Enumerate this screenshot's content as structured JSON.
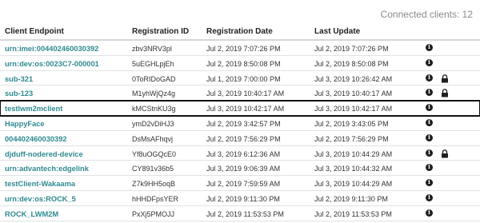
{
  "connected_clients": "Connected clients: 12",
  "columns": {
    "endpoint": "Client Endpoint",
    "registration_id": "Registration ID",
    "registration_date": "Registration Date",
    "last_update": "Last Update"
  },
  "colors": {
    "link": "#2e8a91",
    "header_text": "#222222",
    "muted": "#8a8a8a"
  },
  "rows": [
    {
      "endpoint": "urn:imei:004402460030392",
      "reg_id": "zbv3NRV3pl",
      "reg_date": "Jul 2, 2019 7:07:26 PM",
      "last_update": "Jul 2, 2019 7:07:26 PM",
      "icons": [
        "info-icon"
      ]
    },
    {
      "endpoint": "urn:dev:os:0023C7-000001",
      "reg_id": "5uEGHLpjEh",
      "reg_date": "Jul 2, 2019 8:50:08 PM",
      "last_update": "Jul 2, 2019 8:50:08 PM",
      "icons": [
        "info-icon"
      ]
    },
    {
      "endpoint": "sub-321",
      "reg_id": "0ToRIDoGAD",
      "reg_date": "Jul 1, 2019 7:00:00 PM",
      "last_update": "Jul 3, 2019 10:26:42 AM",
      "icons": [
        "info-icon",
        "lock-icon"
      ]
    },
    {
      "endpoint": "sub-123",
      "reg_id": "M1yhWjQz4g",
      "reg_date": "Jul 3, 2019 10:40:17 AM",
      "last_update": "Jul 3, 2019 10:40:17 AM",
      "icons": [
        "info-icon",
        "lock-icon"
      ]
    },
    {
      "endpoint": "testlwm2mclient",
      "reg_id": "kMCStnKU3g",
      "reg_date": "Jul 3, 2019 10:42:17 AM",
      "last_update": "Jul 3, 2019 10:42:17 AM",
      "icons": [
        "info-icon"
      ],
      "selected": true
    },
    {
      "endpoint": "HappyFace",
      "reg_id": "ymD2vDiHJ3",
      "reg_date": "Jul 2, 2019 3:42:57 PM",
      "last_update": "Jul 2, 2019 3:43:05 PM",
      "icons": [
        "info-icon"
      ]
    },
    {
      "endpoint": "004402460030392",
      "reg_id": "DsMsAFhqvj",
      "reg_date": "Jul 2, 2019 7:56:29 PM",
      "last_update": "Jul 2, 2019 7:56:29 PM",
      "icons": [
        "info-icon"
      ]
    },
    {
      "endpoint": "djduff-nodered-device",
      "reg_id": "Yf8uOGQcE0",
      "reg_date": "Jul 3, 2019 6:12:36 AM",
      "last_update": "Jul 3, 2019 10:44:29 AM",
      "icons": [
        "info-icon",
        "lock-icon"
      ]
    },
    {
      "endpoint": "urn:advantech:edgelink",
      "reg_id": "CY891v36b5",
      "reg_date": "Jul 3, 2019 9:06:39 AM",
      "last_update": "Jul 3, 2019 10:44:32 AM",
      "icons": [
        "info-icon"
      ]
    },
    {
      "endpoint": "testClient-Wakaama",
      "reg_id": "Z7k9HH5oqB",
      "reg_date": "Jul 2, 2019 7:59:59 AM",
      "last_update": "Jul 3, 2019 10:44:29 AM",
      "icons": [
        "info-icon"
      ]
    },
    {
      "endpoint": "urn:dev:os:ROCK_5",
      "reg_id": "hHHDFpsYER",
      "reg_date": "Jul 2, 2019 9:11:30 PM",
      "last_update": "Jul 2, 2019 9:11:30 PM",
      "icons": [
        "info-icon"
      ]
    },
    {
      "endpoint": "ROCK_LWM2M",
      "reg_id": "PxXj5PMOJJ",
      "reg_date": "Jul 2, 2019 11:53:53 PM",
      "last_update": "Jul 2, 2019 11:53:53 PM",
      "icons": [
        "info-icon"
      ]
    }
  ]
}
